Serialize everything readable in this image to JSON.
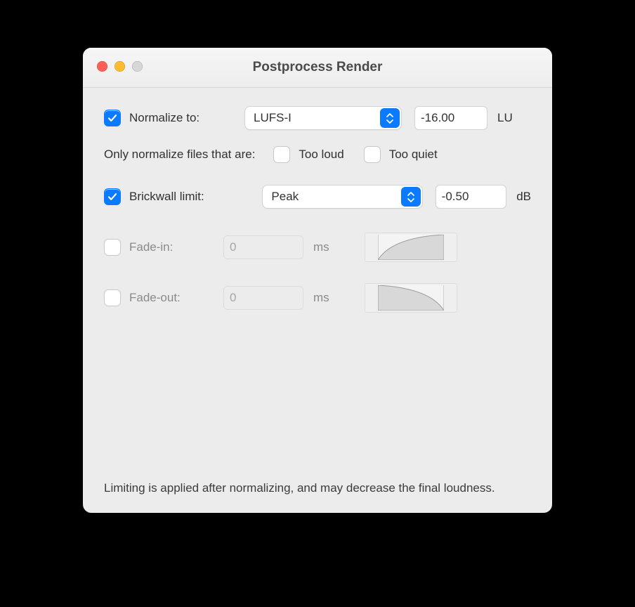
{
  "window": {
    "title": "Postprocess Render"
  },
  "normalize": {
    "checked": true,
    "label": "Normalize to:",
    "method": "LUFS-I",
    "target": "-16.00",
    "unit": "LU"
  },
  "filter": {
    "label": "Only normalize files that are:",
    "too_loud_checked": false,
    "too_loud_label": "Too loud",
    "too_quiet_checked": false,
    "too_quiet_label": "Too quiet"
  },
  "limit": {
    "checked": true,
    "label": "Brickwall limit:",
    "method": "Peak",
    "target": "-0.50",
    "unit": "dB"
  },
  "fade_in": {
    "checked": false,
    "label": "Fade-in:",
    "value": "0",
    "unit": "ms"
  },
  "fade_out": {
    "checked": false,
    "label": "Fade-out:",
    "value": "0",
    "unit": "ms"
  },
  "note": "Limiting is applied after normalizing, and may decrease the final loudness."
}
